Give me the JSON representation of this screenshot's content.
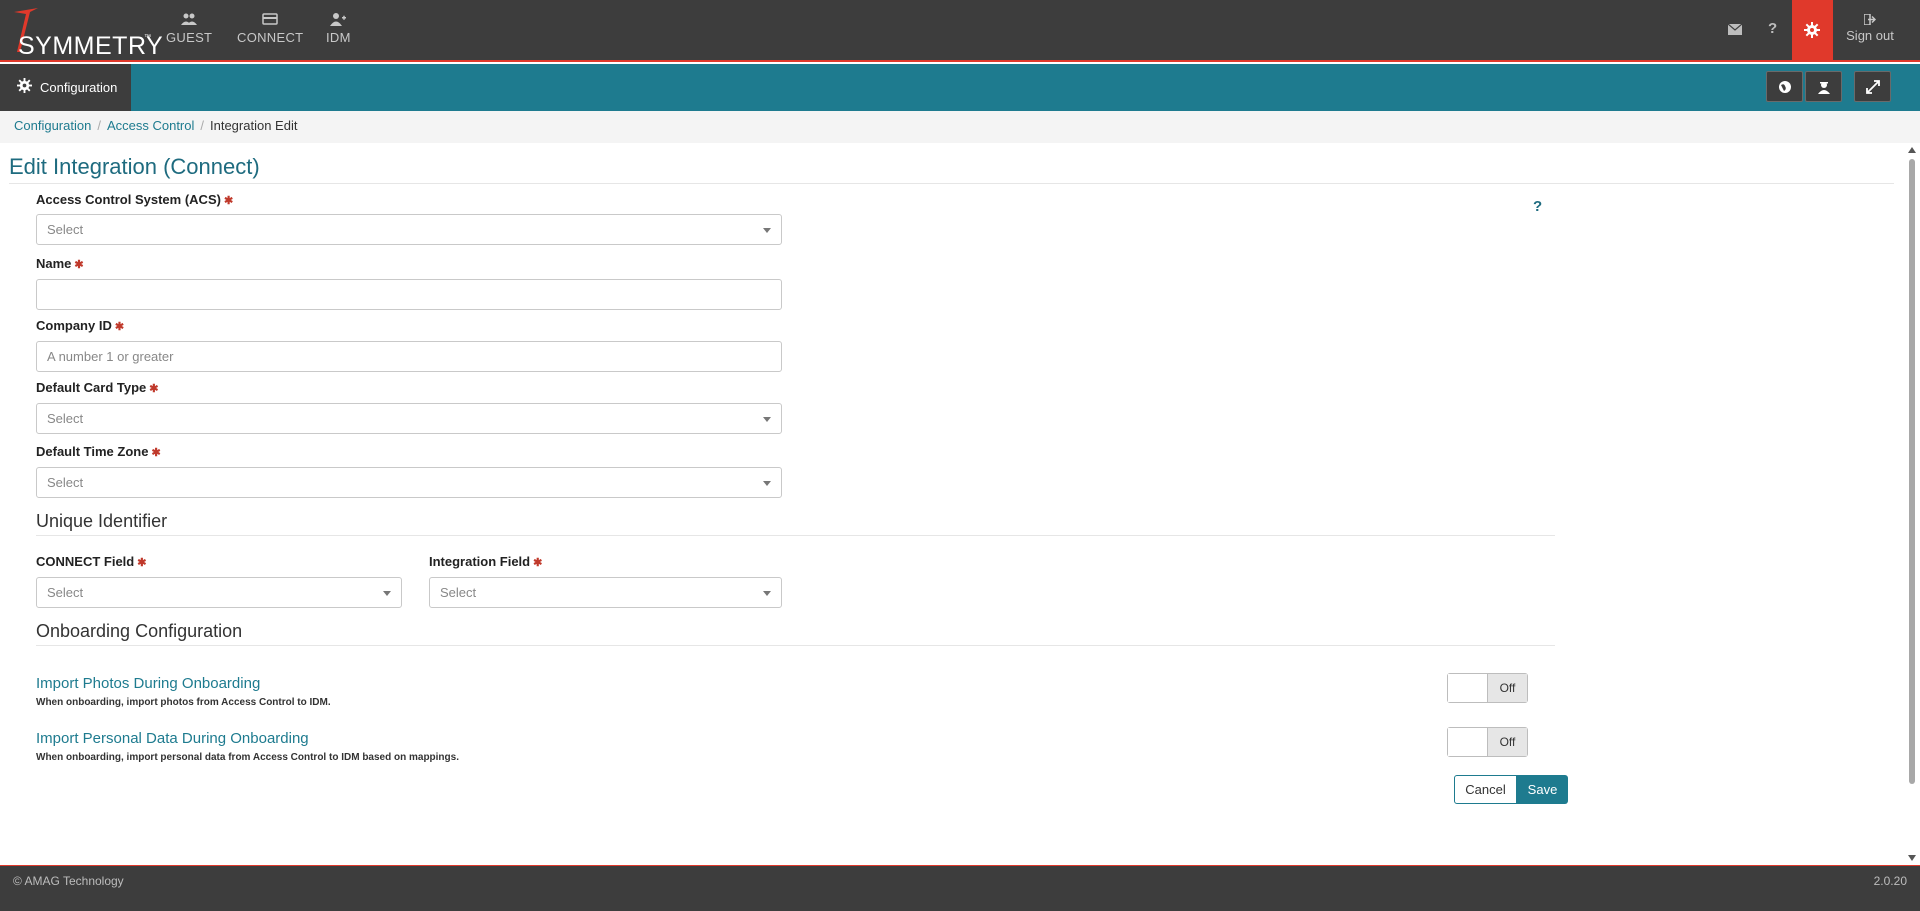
{
  "brand": {
    "name": "SYMMETRY",
    "tm": "™"
  },
  "nav": [
    {
      "label": "GUEST",
      "icon": "users-icon"
    },
    {
      "label": "CONNECT",
      "icon": "card-icon"
    },
    {
      "label": "IDM",
      "icon": "user-plus-icon"
    }
  ],
  "topright": {
    "signout": "Sign out"
  },
  "tealbar": {
    "section": "Configuration"
  },
  "breadcrumb": {
    "items": [
      "Configuration",
      "Access Control"
    ],
    "current": "Integration Edit"
  },
  "page": {
    "title": "Edit Integration (Connect)",
    "help": "?"
  },
  "form": {
    "required_mark": "✱",
    "acs": {
      "label": "Access Control System (ACS)",
      "value": "Select"
    },
    "name": {
      "label": "Name",
      "value": ""
    },
    "company_id": {
      "label": "Company ID",
      "placeholder": "A number 1 or greater"
    },
    "card_type": {
      "label": "Default Card Type",
      "value": "Select"
    },
    "time_zone": {
      "label": "Default Time Zone",
      "value": "Select"
    }
  },
  "unique": {
    "heading": "Unique Identifier",
    "connect_field": {
      "label": "CONNECT Field",
      "value": "Select"
    },
    "integration_field": {
      "label": "Integration Field",
      "value": "Select"
    }
  },
  "onboarding": {
    "heading": "Onboarding Configuration",
    "photos": {
      "title": "Import Photos During Onboarding",
      "desc": "When onboarding, import photos from Access Control to IDM.",
      "state": "Off"
    },
    "personal": {
      "title": "Import Personal Data During Onboarding",
      "desc": "When onboarding, import personal data from Access Control to IDM based on mappings.",
      "state": "Off"
    }
  },
  "actions": {
    "cancel": "Cancel",
    "save": "Save"
  },
  "footer": {
    "copyright": "© AMAG Technology",
    "version": "2.0.20"
  },
  "colors": {
    "dark": "#3d3d3d",
    "teal": "#1e7b8f",
    "accent": "#e0392b"
  }
}
